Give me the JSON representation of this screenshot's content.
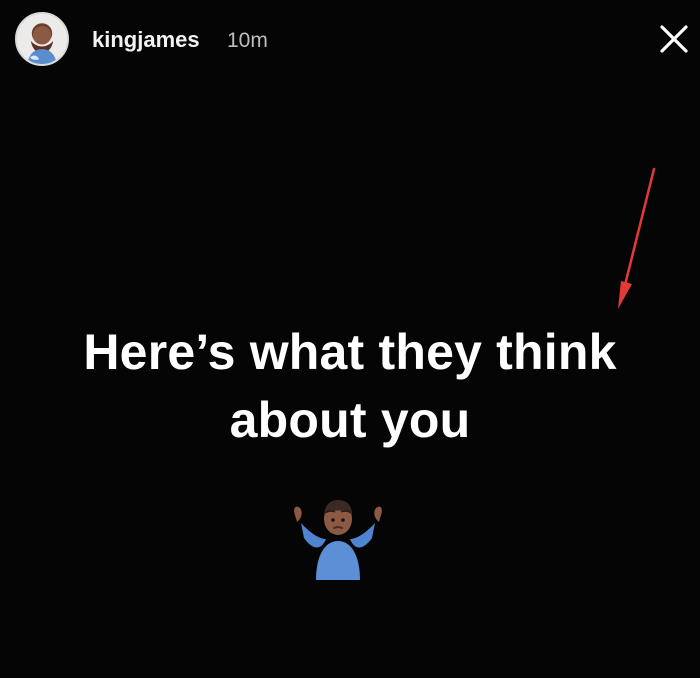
{
  "story": {
    "username": "kingjames",
    "timestamp": "10m",
    "caption_line1": "Here’s what they think",
    "caption_line2": "about you",
    "sticker": "person-shrugging-emoji"
  },
  "icons": {
    "close": "close-icon",
    "annotation": "red-arrow-icon"
  },
  "colors": {
    "background": "#050505",
    "text": "#ffffff",
    "muted_text": "#bdbdbd",
    "annotation_arrow": "#e53935",
    "emoji_shirt": "#5b8fd6"
  }
}
